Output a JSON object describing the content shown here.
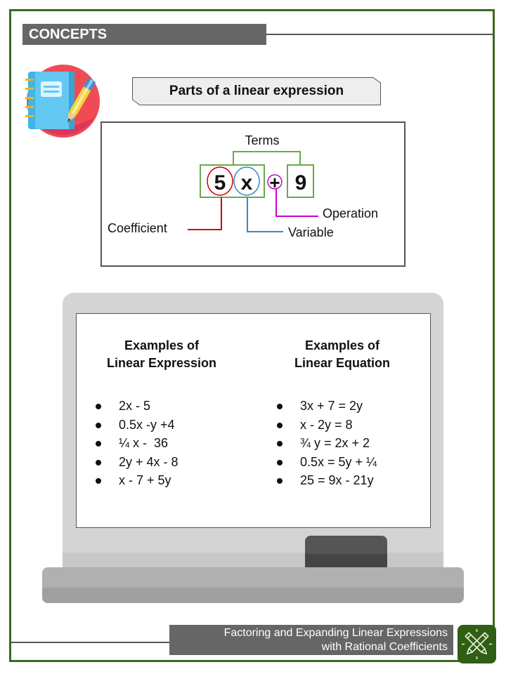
{
  "header": {
    "section_label": "CONCEPTS"
  },
  "icons": {
    "notebook": "notebook-with-pen-icon",
    "footer_badge": "crossed-pencils-icon"
  },
  "diagram": {
    "title": "Parts of a linear expression",
    "terms_label": "Terms",
    "coefficient_value": "5",
    "variable_value": "x",
    "operation_value": "+",
    "constant_value": "9",
    "labels": {
      "coefficient": "Coefficient",
      "variable": "Variable",
      "operation": "Operation"
    },
    "colors": {
      "terms": "#6aa84f",
      "coefficient": "#cc0000",
      "variable": "#3d85c6",
      "operation": "#cc00cc"
    }
  },
  "examples": {
    "expressions": {
      "heading_line1": "Examples of",
      "heading_line2": "Linear Expression",
      "items": [
        "2x - 5",
        "0.5x -y +4",
        "¼ x -  36",
        "2y + 4x - 8",
        "x - 7 + 5y"
      ]
    },
    "equations": {
      "heading_line1": "Examples of",
      "heading_line2": "Linear Equation",
      "items": [
        "3x + 7 = 2y",
        "x - 2y = 8",
        "¾ y = 2x + 2",
        "0.5x = 5y + ¼",
        "25 = 9x - 21y"
      ]
    }
  },
  "footer": {
    "title_line1": "Factoring and Expanding Linear Expressions",
    "title_line2": "with Rational Coefficients"
  }
}
